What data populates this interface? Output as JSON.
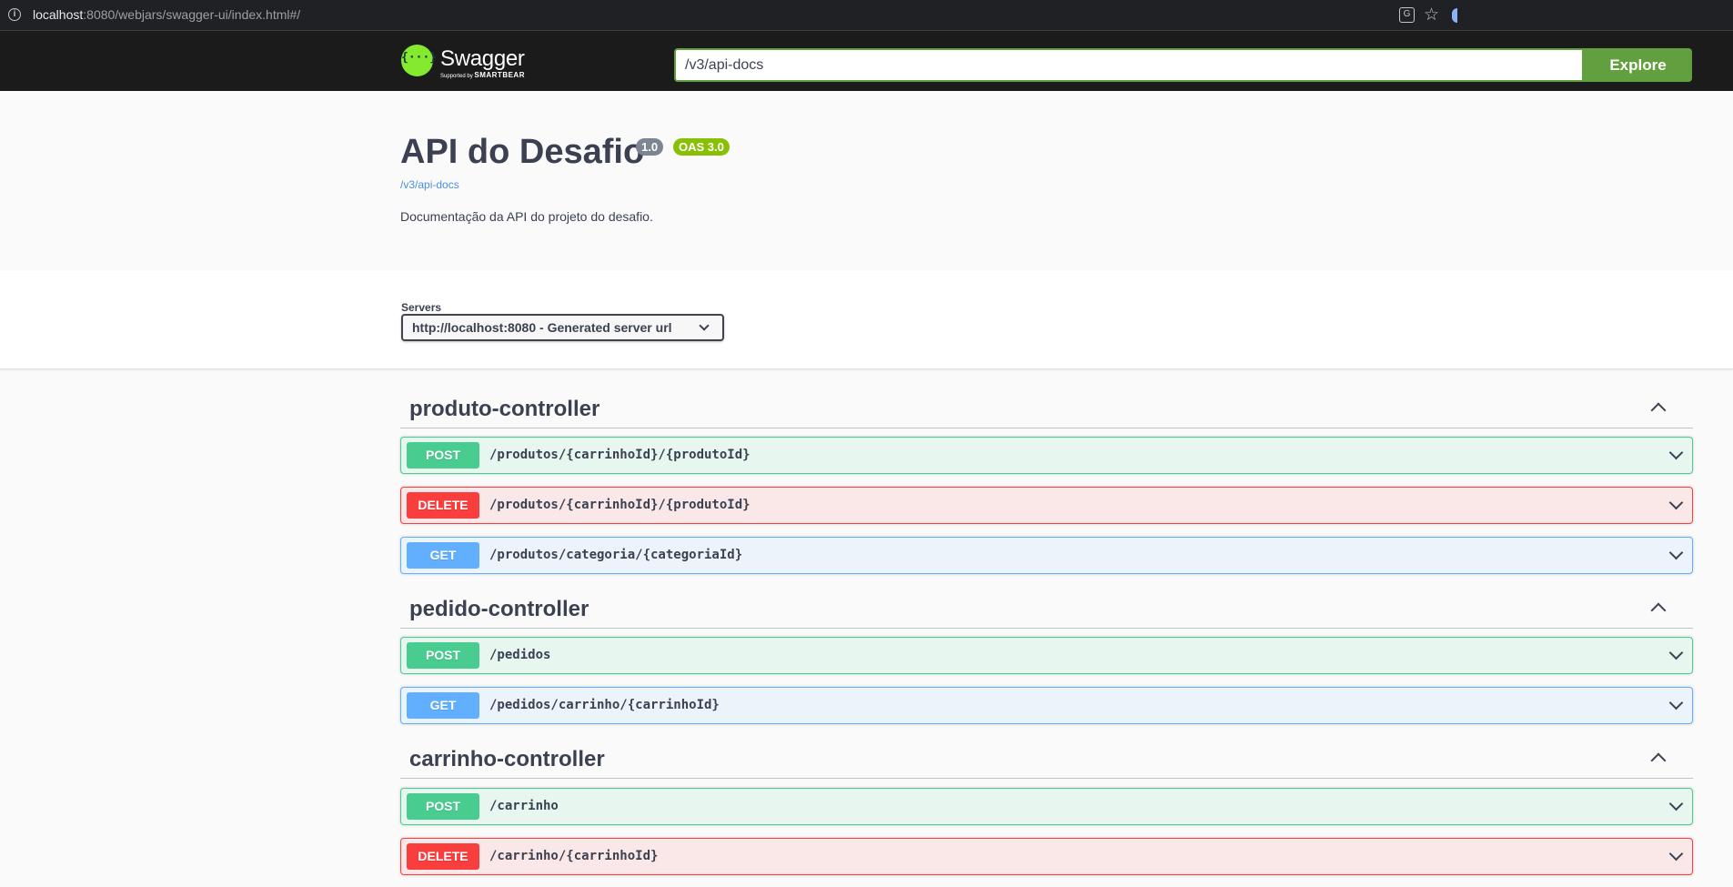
{
  "browser": {
    "url_host": "localhost",
    "url_rest": ":8080/webjars/swagger-ui/index.html#/"
  },
  "topbar": {
    "logo_name": "Swagger",
    "logo_sub_prefix": "Supported by",
    "logo_sub_brand": "SMARTBEAR",
    "logo_glyph": "{···}",
    "api_url": "/v3/api-docs",
    "explore_label": "Explore"
  },
  "info": {
    "title": "API do Desafio",
    "version_badge": "1.0",
    "oas_badge": "OAS 3.0",
    "docs_link": "/v3/api-docs",
    "description": "Documentação da API do projeto do desafio."
  },
  "servers": {
    "label": "Servers",
    "selected": "http://localhost:8080 - Generated server url"
  },
  "tags": [
    {
      "name": "produto-controller",
      "operations": [
        {
          "method": "POST",
          "path": "/produtos/{carrinhoId}/{produtoId}"
        },
        {
          "method": "DELETE",
          "path": "/produtos/{carrinhoId}/{produtoId}"
        },
        {
          "method": "GET",
          "path": "/produtos/categoria/{categoriaId}"
        }
      ]
    },
    {
      "name": "pedido-controller",
      "operations": [
        {
          "method": "POST",
          "path": "/pedidos"
        },
        {
          "method": "GET",
          "path": "/pedidos/carrinho/{carrinhoId}"
        }
      ]
    },
    {
      "name": "carrinho-controller",
      "operations": [
        {
          "method": "POST",
          "path": "/carrinho"
        },
        {
          "method": "DELETE",
          "path": "/carrinho/{carrinhoId}"
        }
      ]
    }
  ],
  "colors": {
    "post": "#49cc90",
    "delete": "#f93e3e",
    "get": "#61affe",
    "explore": "#62a03f",
    "logo": "#85ea2d",
    "oas_badge": "#89bf04"
  }
}
